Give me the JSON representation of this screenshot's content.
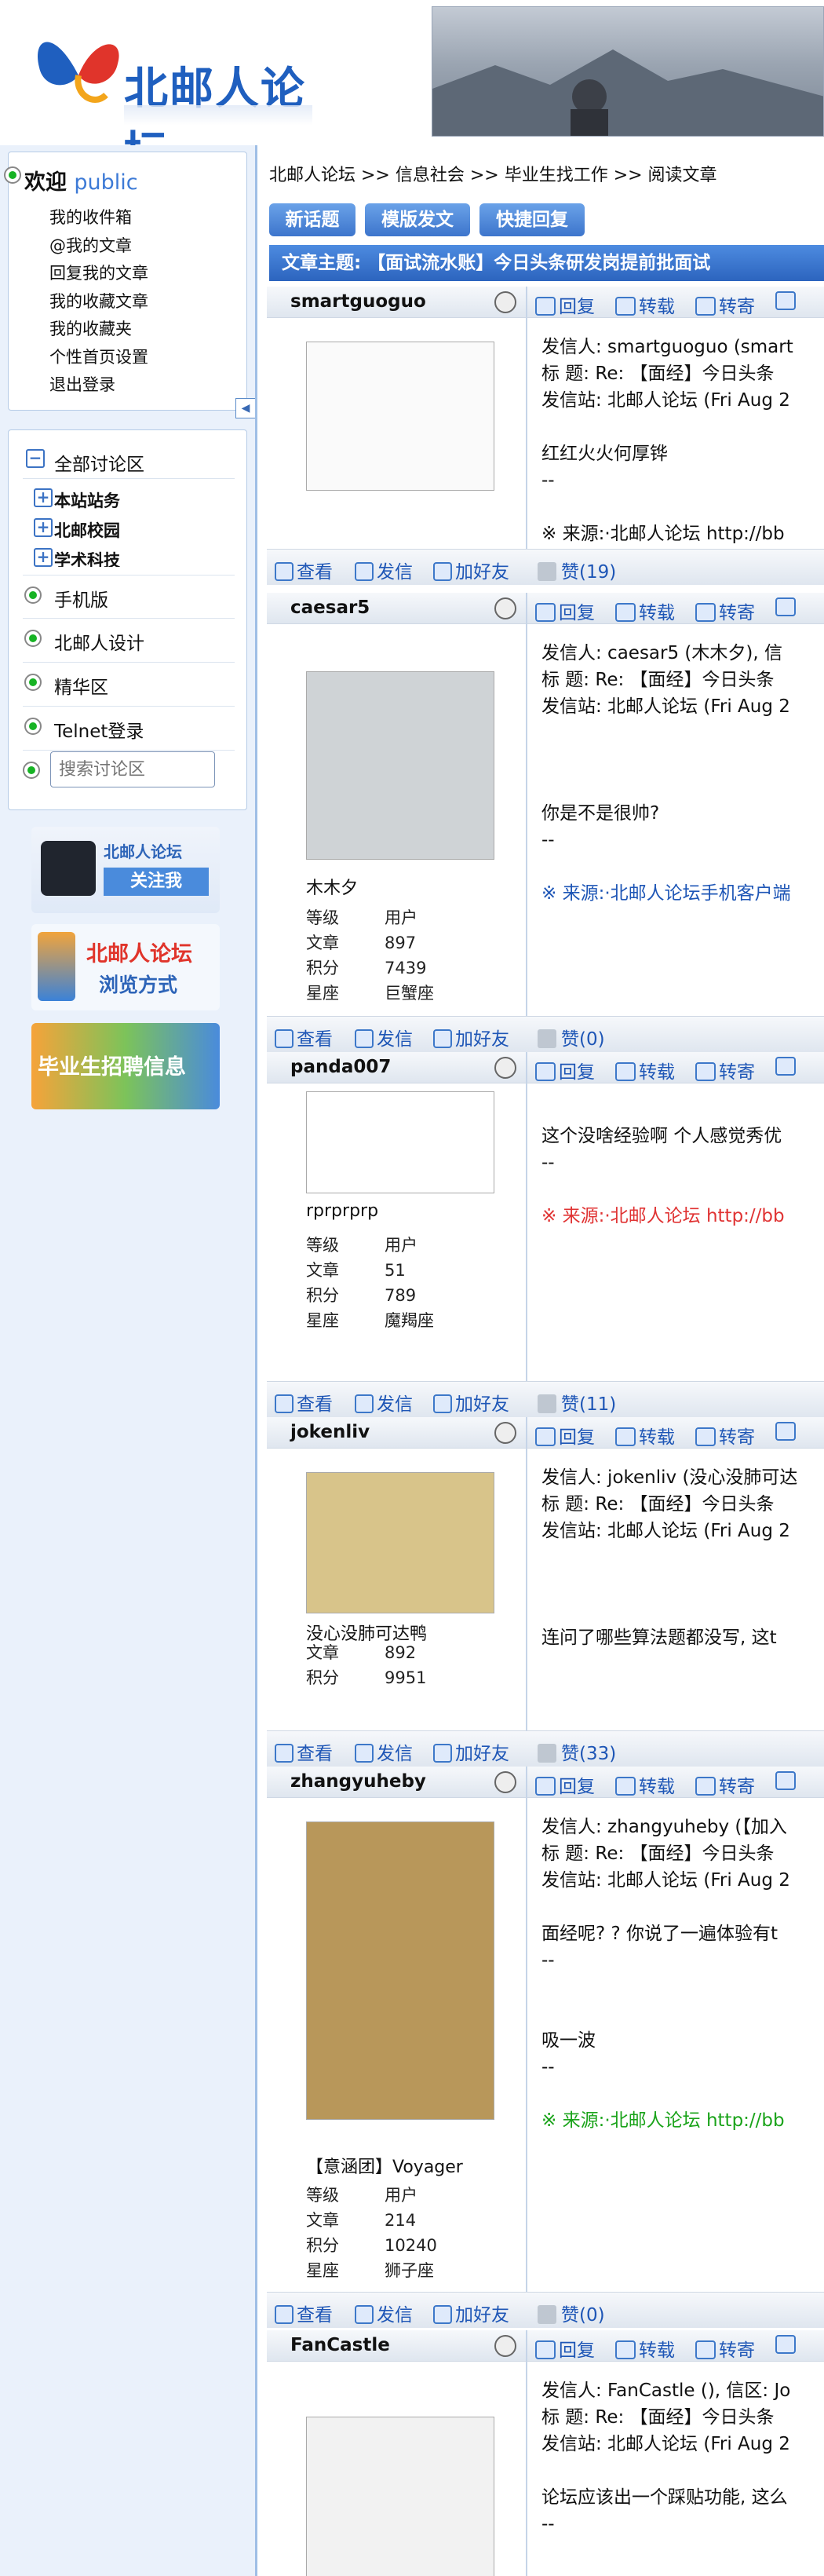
{
  "site": {
    "title": "北邮人论坛"
  },
  "sidebar": {
    "welcome": {
      "label": "欢迎",
      "user": "public"
    },
    "links": [
      "我的收件箱",
      "@我的文章",
      "回复我的文章",
      "我的收藏文章",
      "我的收藏夹",
      "个性首页设置",
      "退出登录"
    ],
    "forum_all": "全部讨论区",
    "sub": [
      "本站站务",
      "北邮校园",
      "学术科技"
    ],
    "menu": [
      "手机版",
      "北邮人设计",
      "精华区",
      "Telnet登录"
    ],
    "search_placeholder": "搜索讨论区",
    "badges": {
      "follow": {
        "title": "北邮人论坛",
        "action": "关注我"
      },
      "browse": {
        "title": "北邮人论坛",
        "action": "浏览方式"
      },
      "jobs": {
        "title": "毕业生招聘信息"
      }
    }
  },
  "breadcrumb": "北邮人论坛 >> 信息社会 >> 毕业生找工作 >> 阅读文章",
  "toolbar": {
    "new": "新话题",
    "template": "模版发文",
    "quick": "快捷回复"
  },
  "subject": "文章主题: 【面试流水账】今日头条研发岗提前批面试",
  "actions": {
    "reply": "回复",
    "forward": "转载",
    "send": "转寄"
  },
  "footer_actions": {
    "view": "查看",
    "mail": "发信",
    "friend": "加好友"
  },
  "posts": [
    {
      "user": "smartguoguo",
      "content": [
        "发信人: smartguoguo (smart",
        "标  题: Re: 【面经】今日头条",
        "发信站: 北邮人论坛 (Fri Aug 2",
        "",
        "红红火火何厚铧",
        "--",
        "",
        "※ 来源:·北邮人论坛 http://bb"
      ],
      "likes": "赞(19)"
    },
    {
      "user": "caesar5",
      "display_name": "木木夕",
      "stats": [
        [
          "等级",
          "用户"
        ],
        [
          "文章",
          "897"
        ],
        [
          "积分",
          "7439"
        ],
        [
          "星座",
          "巨蟹座"
        ]
      ],
      "content": [
        "发信人: caesar5 (木木夕), 信",
        "标  题: Re: 【面经】今日头条",
        "发信站: 北邮人论坛 (Fri Aug 2",
        "",
        "",
        "",
        "你是不是很帅?",
        "--",
        "",
        "※ 来源:·北邮人论坛手机客户端"
      ],
      "likes": "赞(0)"
    },
    {
      "user": "panda007",
      "display_name": "rprprprp",
      "stats": [
        [
          "等级",
          "用户"
        ],
        [
          "文章",
          "51"
        ],
        [
          "积分",
          "789"
        ],
        [
          "星座",
          "魔羯座"
        ]
      ],
      "content": [
        "这个没啥经验啊 个人感觉秀优",
        "--",
        "",
        "※ 来源:·北邮人论坛 http://bb"
      ],
      "likes": "赞(11)"
    },
    {
      "user": "jokenliv",
      "display_name": "没心没肺可达鸭",
      "stats": [
        [
          "文章",
          "892"
        ],
        [
          "积分",
          "9951"
        ]
      ],
      "content": [
        "发信人: jokenliv (没心没肺可达",
        "标  题: Re: 【面经】今日头条",
        "发信站: 北邮人论坛 (Fri Aug 2",
        "",
        "",
        "",
        "连问了哪些算法题都没写, 这t"
      ],
      "likes": "赞(33)"
    },
    {
      "user": "zhangyuheby",
      "display_name": "【意涵团】Voyager",
      "stats": [
        [
          "等级",
          "用户"
        ],
        [
          "文章",
          "214"
        ],
        [
          "积分",
          "10240"
        ],
        [
          "星座",
          "狮子座"
        ]
      ],
      "content": [
        "发信人: zhangyuheby (【加入",
        "标  题: Re: 【面经】今日头条",
        "发信站: 北邮人论坛 (Fri Aug 2",
        "",
        "面经呢? ? 你说了一遍体验有t",
        "--",
        "",
        "",
        "吸一波",
        "--",
        "",
        "※ 来源:·北邮人论坛 http://bb"
      ],
      "likes": "赞(0)"
    },
    {
      "user": "FanCastle",
      "content": [
        "发信人: FanCastle (), 信区: Jo",
        "标  题: Re: 【面经】今日头条",
        "发信站: 北邮人论坛 (Fri Aug 2",
        "",
        "论坛应该出一个踩贴功能, 这么",
        "--"
      ]
    }
  ],
  "colors": {
    "accent": "#3d75cc",
    "sidebar_bg": "#eaf1fb",
    "source_green": "#1aa31a",
    "source_red": "#e03333"
  }
}
